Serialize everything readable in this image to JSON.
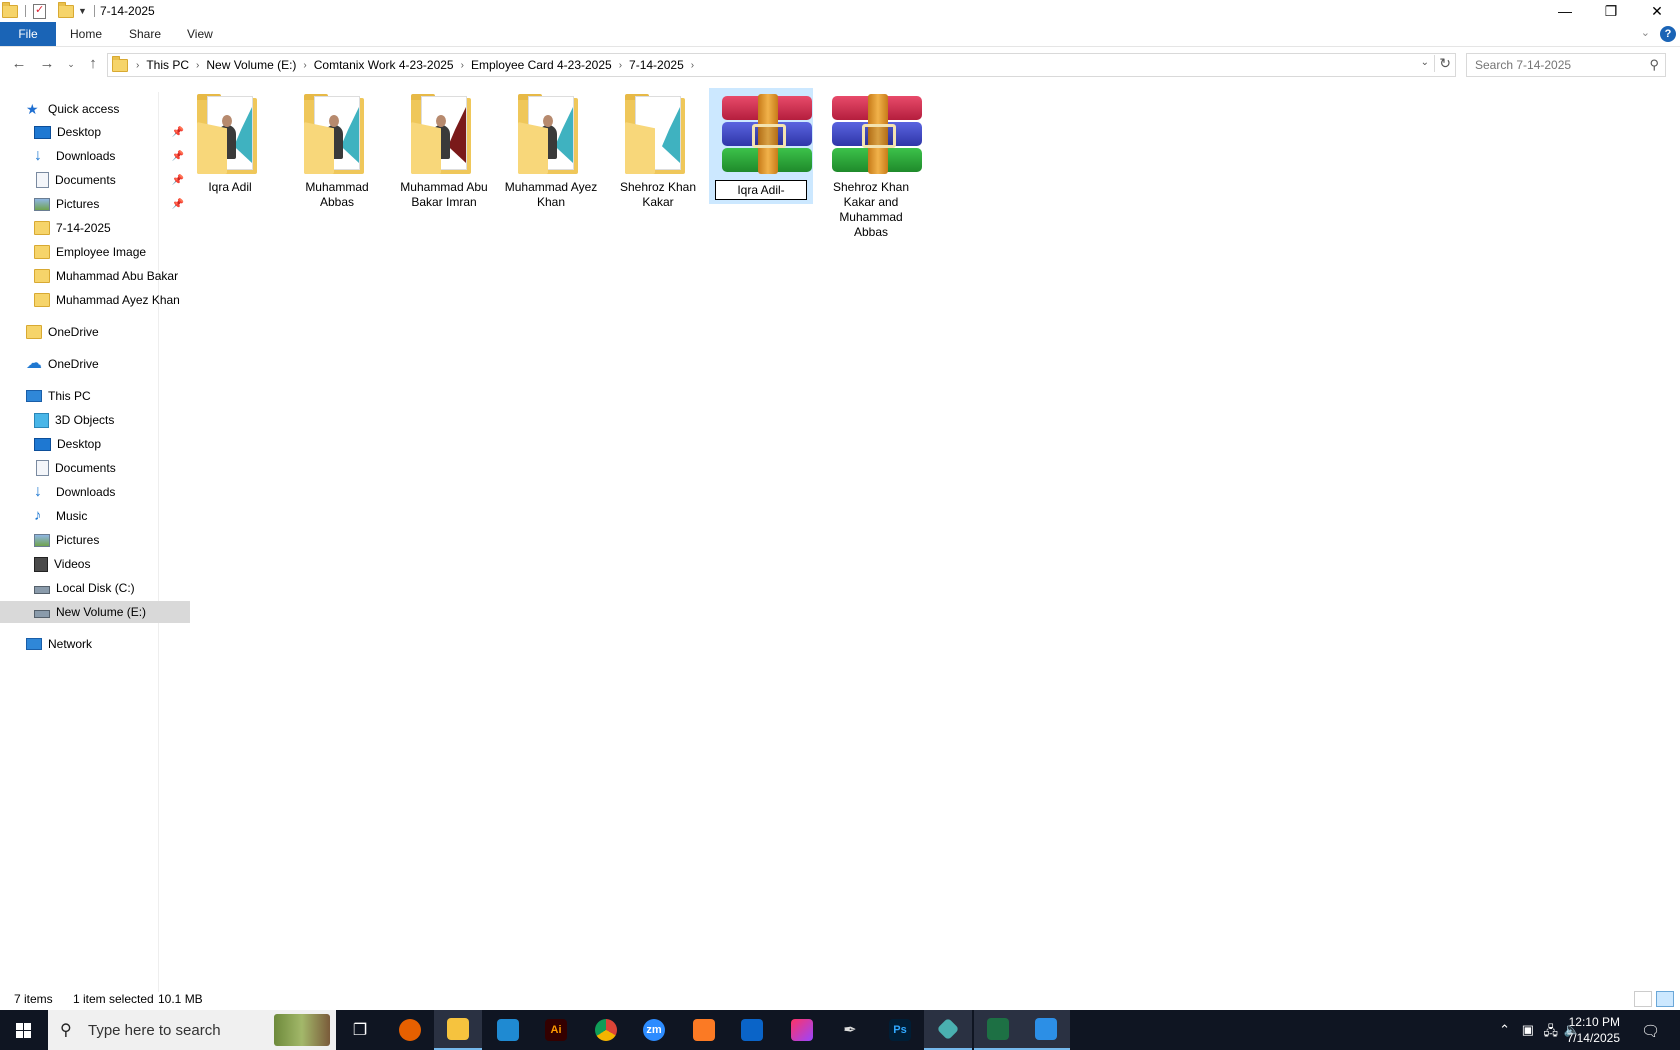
{
  "window": {
    "title": "7-14-2025",
    "controls": {
      "minimize": "—",
      "restore": "❐",
      "close": "✕"
    }
  },
  "ribbon": {
    "tabs": [
      "File",
      "Home",
      "Share",
      "View"
    ]
  },
  "address": {
    "breadcrumbs": [
      "This PC",
      "New Volume (E:)",
      "Comtanix Work 4-23-2025",
      "Employee Card 4-23-2025",
      "7-14-2025"
    ],
    "search_placeholder": "Search 7-14-2025"
  },
  "navpane": {
    "quick_access": "Quick access",
    "quick_items": [
      {
        "label": "Desktop",
        "icon": "desktop-icon",
        "pinned": true
      },
      {
        "label": "Downloads",
        "icon": "downloads-icon",
        "pinned": true
      },
      {
        "label": "Documents",
        "icon": "documents-icon",
        "pinned": true
      },
      {
        "label": "Pictures",
        "icon": "pictures-icon",
        "pinned": true
      },
      {
        "label": "7-14-2025",
        "icon": "folder-icon"
      },
      {
        "label": "Employee Image",
        "icon": "folder-icon"
      },
      {
        "label": "Muhammad Abu Bakar",
        "icon": "folder-icon"
      },
      {
        "label": "Muhammad Ayez Khan",
        "icon": "folder-icon"
      }
    ],
    "onedrive_1": "OneDrive",
    "onedrive_2": "OneDrive",
    "this_pc": "This PC",
    "pc_items": [
      {
        "label": "3D Objects",
        "icon": "3d-objects-icon"
      },
      {
        "label": "Desktop",
        "icon": "desktop-icon"
      },
      {
        "label": "Documents",
        "icon": "documents-icon"
      },
      {
        "label": "Downloads",
        "icon": "downloads-icon"
      },
      {
        "label": "Music",
        "icon": "music-icon"
      },
      {
        "label": "Pictures",
        "icon": "pictures-icon"
      },
      {
        "label": "Videos",
        "icon": "videos-icon"
      },
      {
        "label": "Local Disk (C:)",
        "icon": "disk-icon"
      },
      {
        "label": "New Volume (E:)",
        "icon": "disk-icon",
        "selected": true
      }
    ],
    "network": "Network"
  },
  "content": {
    "items": [
      {
        "name": "Iqra Adil",
        "type": "folder"
      },
      {
        "name": "Muhammad Abbas",
        "type": "folder"
      },
      {
        "name": "Muhammad Abu Bakar Imran",
        "type": "folder"
      },
      {
        "name": "Muhammad Ayez Khan",
        "type": "folder"
      },
      {
        "name": "Shehroz Khan Kakar",
        "type": "folder"
      },
      {
        "name": "Iqra Adil-",
        "type": "archive",
        "selected": true,
        "renaming": true
      },
      {
        "name": "Shehroz Khan Kakar and Muhammad Abbas",
        "type": "archive"
      }
    ]
  },
  "status": {
    "count": "7 items",
    "selection": "1 item selected",
    "size": "10.1 MB"
  },
  "taskbar": {
    "search_text": "Type here to search",
    "time": "12:10 PM",
    "date": "7/14/2025"
  }
}
